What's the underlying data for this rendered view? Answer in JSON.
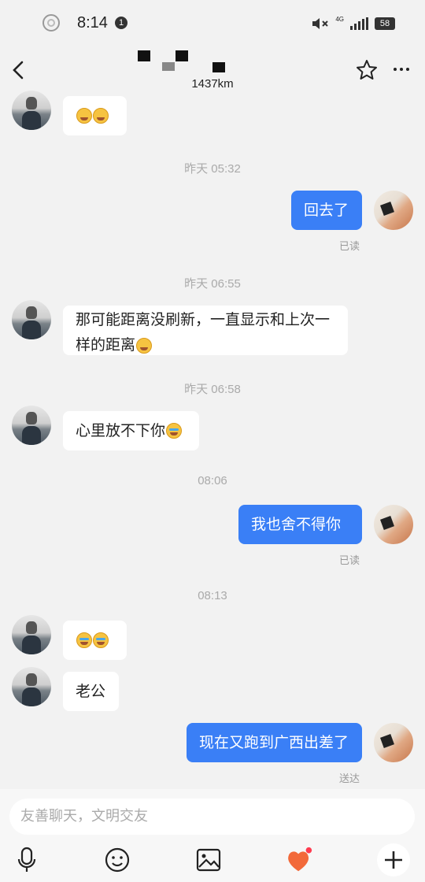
{
  "status_bar": {
    "time": "8:14",
    "notification_count": "1",
    "network": "4G",
    "battery": "58"
  },
  "header": {
    "distance": "1437km"
  },
  "messages": [
    {
      "timestamp": "昨天 05:32"
    },
    {
      "text": "回去了",
      "read": "已读"
    },
    {
      "timestamp": "昨天 06:55"
    },
    {
      "text_line1": "那可能距离没刷新，一直显示和上次一",
      "text_line2": "样的距离"
    },
    {
      "timestamp": "昨天 06:58"
    },
    {
      "text": "心里放不下你"
    },
    {
      "timestamp": "08:06"
    },
    {
      "text": "我也舍不得你",
      "read": "已读"
    },
    {
      "timestamp": "08:13"
    },
    {
      "text": "老公"
    },
    {
      "text": "现在又跑到广西出差了",
      "status": "送达"
    }
  ],
  "input": {
    "placeholder": "友善聊天，文明交友"
  },
  "toolbar": {
    "icons": [
      "microphone-icon",
      "emoji-icon",
      "image-icon",
      "gift-heart-icon",
      "plus-icon"
    ]
  },
  "colors": {
    "outgoing_bubble": "#3a7ff6",
    "incoming_bubble": "#ffffff",
    "background": "#f2f2f2"
  }
}
